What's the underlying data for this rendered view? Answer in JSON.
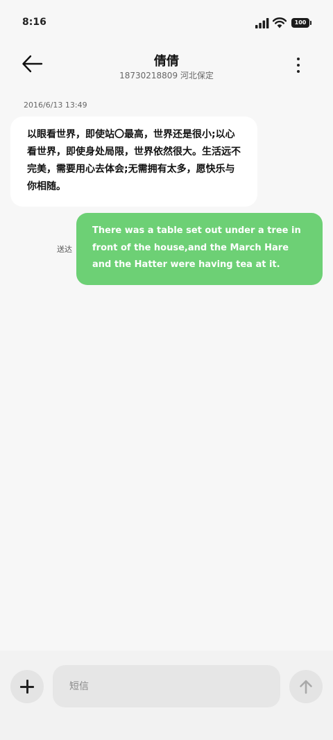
{
  "status_bar": {
    "time": "8:16",
    "battery": "100",
    "icons": [
      "signal-icon",
      "wifi-icon",
      "battery-icon"
    ]
  },
  "header": {
    "contact_name": "倩倩",
    "contact_subtitle": "18730218809 河北保定",
    "icons": [
      "back-arrow-icon",
      "more-options-icon"
    ]
  },
  "conversation": {
    "timestamp": "2016/6/13 13:49",
    "messages": [
      {
        "direction": "incoming",
        "text": "以眼看世界，即使站〇最高，世界还是很小;以心看世界，即使身处局限，世界依然很大。生活远不完美，需要用心去体会;无需拥有太多，愿快乐与你相随。"
      },
      {
        "direction": "outgoing",
        "status": "送达",
        "text": "There was a table set out under a tree in front of the house,and the March Hare and the Hatter were having tea at it."
      }
    ]
  },
  "composer": {
    "placeholder": "短信",
    "value": "",
    "icons": [
      "plus-icon",
      "send-arrow-icon"
    ]
  },
  "colors": {
    "background": "#f7f7f7",
    "incoming_bubble": "#ffffff",
    "outgoing_bubble": "#6dd075",
    "outgoing_text": "#ffffff",
    "button_bg": "#e4e4e4"
  }
}
